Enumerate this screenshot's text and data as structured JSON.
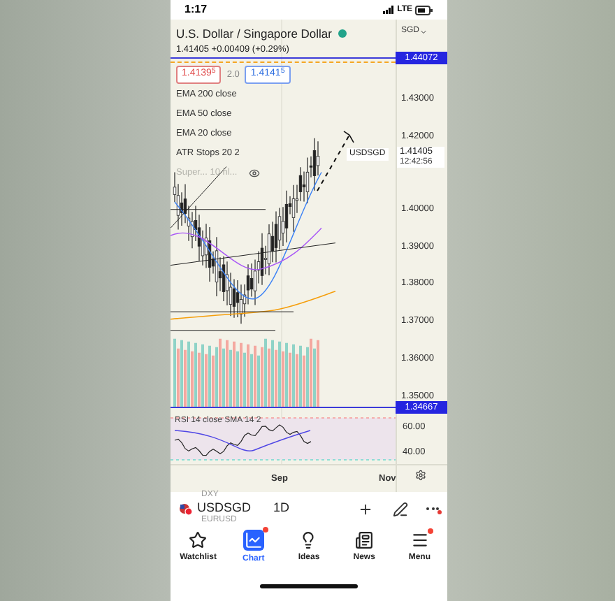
{
  "status_bar": {
    "time": "1:17",
    "network": "LTE"
  },
  "header": {
    "title": "U.S. Dollar / Singapore Dollar",
    "currency": "SGD",
    "market_open": true,
    "price_line": "1.41405 +0.00409 (+0.29%)"
  },
  "quote": {
    "sell": "1.4139$^{5}$",
    "spread": "2.0",
    "buy": "1.4141$^{5}$"
  },
  "indicators": [
    {
      "label": "EMA 200 close",
      "hidden": false
    },
    {
      "label": "EMA 50 close",
      "hidden": false
    },
    {
      "label": "EMA 20 close",
      "hidden": false
    },
    {
      "label": "ATR Stops 20 2",
      "hidden": false
    },
    {
      "label": "Super... 10 hl...",
      "hidden": true
    }
  ],
  "price_axis": [
    {
      "label": "1.44072",
      "kind": "marker"
    },
    {
      "label": "1.43000",
      "kind": "tick"
    },
    {
      "label": "1.42000",
      "kind": "tick"
    },
    {
      "label": "1.40000",
      "kind": "tick"
    },
    {
      "label": "1.39000",
      "kind": "tick"
    },
    {
      "label": "1.38000",
      "kind": "tick"
    },
    {
      "label": "1.37000",
      "kind": "tick"
    },
    {
      "label": "1.36000",
      "kind": "tick"
    },
    {
      "label": "1.35000",
      "kind": "tick"
    },
    {
      "label": "1.34667",
      "kind": "marker"
    }
  ],
  "last_price": {
    "symbol": "USDSGD",
    "price": "1.41405",
    "countdown": "12:42:56"
  },
  "rsi": {
    "legend": "RSI 14 close SMA 14 2",
    "ticks": [
      "60.00",
      "40.00"
    ]
  },
  "time_axis": [
    "Sep",
    "Nov"
  ],
  "symbol_bar": {
    "symbol": "USDSGD",
    "interval": "1D",
    "ghost_symbols": [
      "DXY",
      "EURUSD"
    ]
  },
  "tabs": [
    {
      "label": "Watchlist",
      "selected": false,
      "badge": false
    },
    {
      "label": "Chart",
      "selected": true,
      "badge": true
    },
    {
      "label": "Ideas",
      "selected": false,
      "badge": false
    },
    {
      "label": "News",
      "selected": false,
      "badge": false
    },
    {
      "label": "Menu",
      "selected": false,
      "badge": true
    }
  ]
}
